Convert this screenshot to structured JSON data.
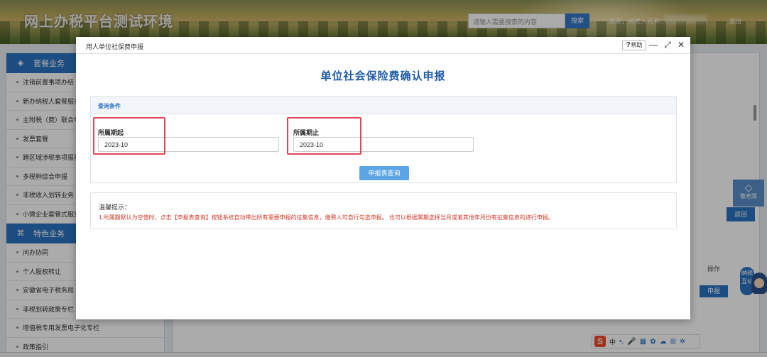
{
  "header": {
    "site_title": "网上办税平台测试环境",
    "search_placeholder": "请输入需要搜索的内容",
    "search_button": "搜索",
    "welcome_prefix": "欢迎，纳税人名称：",
    "logout": "退出"
  },
  "sidebar": {
    "section1": {
      "title": "套餐业务",
      "items": [
        "注销前置事项办结",
        "新办纳税人套餐服务",
        "主附税（费）联合申报",
        "发票套餐",
        "跨区域涉税事项报验",
        "多税种综合申报",
        "非税收入划转业务",
        "小微企业套餐式服务"
      ]
    },
    "section2": {
      "title": "特色业务",
      "items": [
        "问办协同",
        "个人股权转让",
        "安徽省电子税务局",
        "非税划转政策专栏",
        "增值税专用发票电子化专栏",
        "政策指引"
      ]
    }
  },
  "background": {
    "float_tool_label": "敬老版",
    "back_button": "返回",
    "op_column": "操作",
    "declare_button": "申报",
    "mascot_badge": "纳税互动"
  },
  "modal": {
    "window_title": "用人单位社保费申报",
    "help": "帮助",
    "heading": "单位社会保险费确认申报",
    "query": {
      "section_title": "查询条件",
      "start_label": "所属期起",
      "start_value": "2023-10",
      "end_label": "所属期止",
      "end_value": "2023-10",
      "query_button": "申报表查询"
    },
    "tips": {
      "title": "温馨提示：",
      "text": "1.所属期默认为空值时，点击【申报表查询】按钮系统自动带出所有需要申报的征集信息，缴费人可自行勾选申报。 也可以根据属期选择当月或者其他年月份有征集信息的进行申报。"
    }
  },
  "ime": {
    "logo": "S",
    "mode": "中"
  },
  "colors": {
    "primary": "#2b73c2",
    "heading": "#1e5aa8",
    "highlight": "#e0475a",
    "tip_text": "#d23a2a",
    "query_button": "#5ba5e6"
  }
}
